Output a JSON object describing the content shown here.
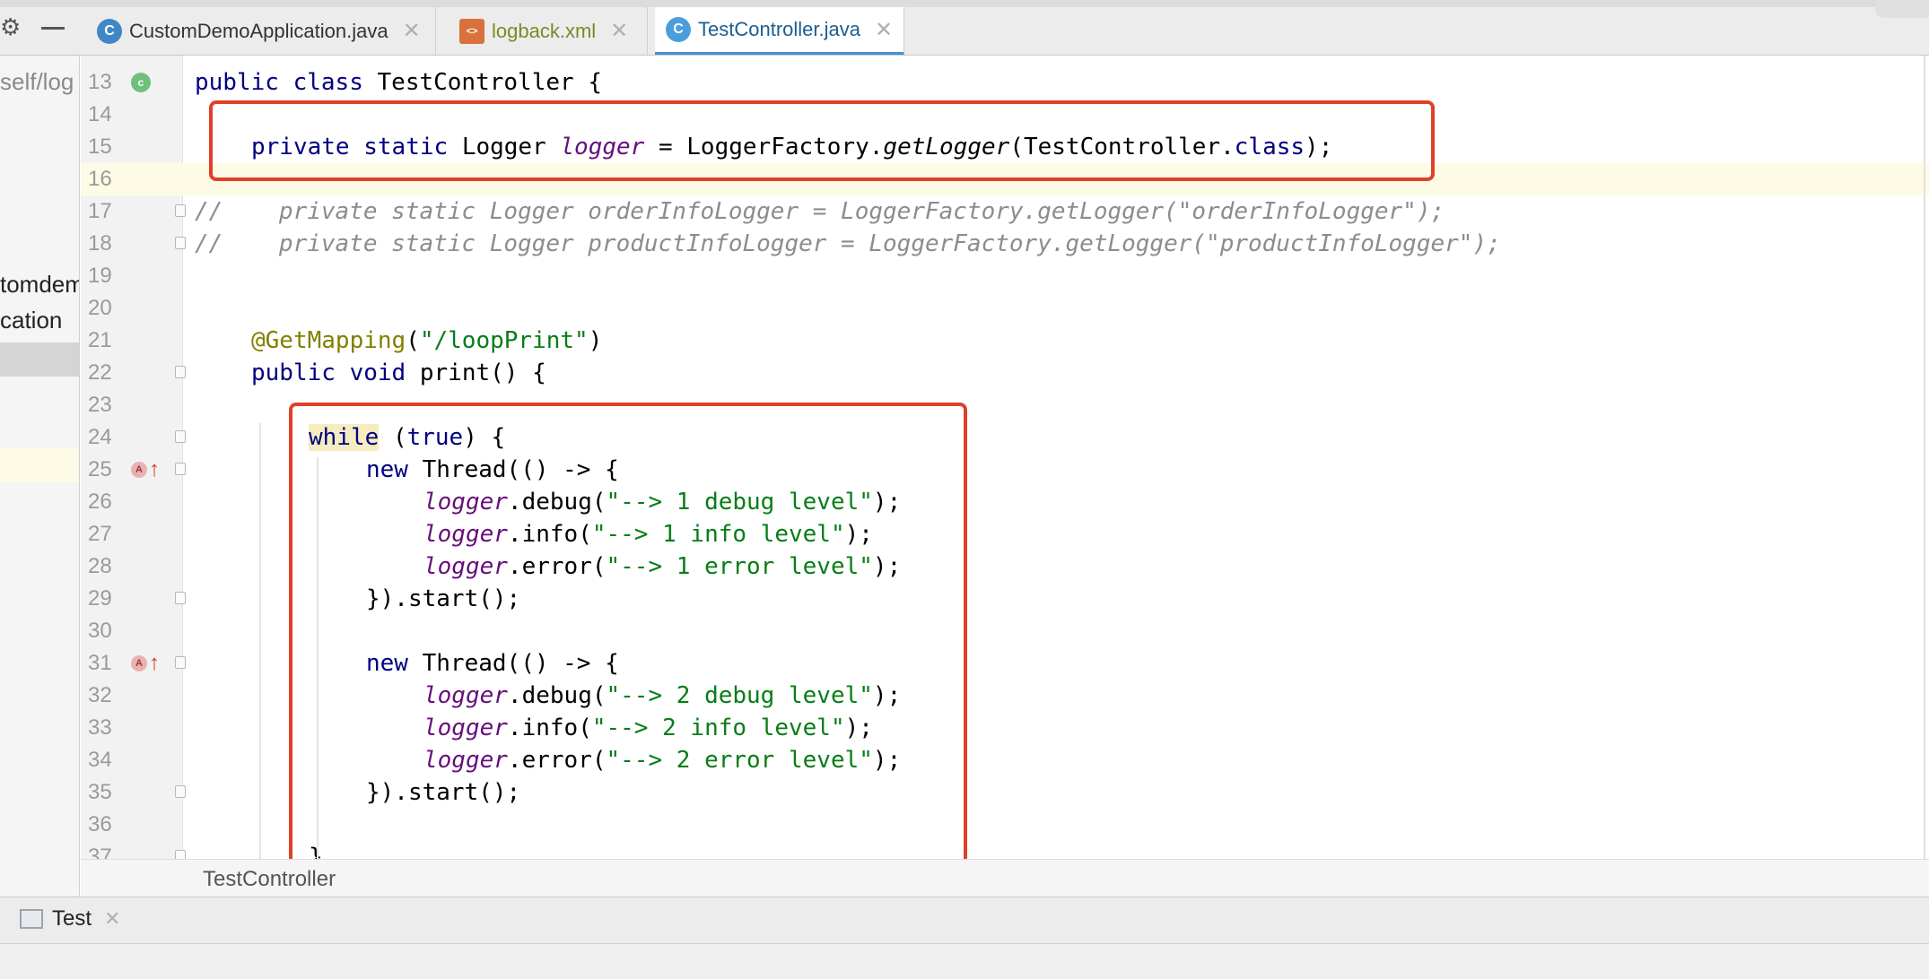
{
  "tabs": [
    {
      "label": "CustomDemoApplication.java",
      "icon": "java-class-run-icon",
      "active": false
    },
    {
      "label": "logback.xml",
      "icon": "xml-file-icon",
      "active": false
    },
    {
      "label": "TestController.java",
      "icon": "java-class-icon",
      "active": true
    }
  ],
  "toolbar": {
    "settings_icon": "gear-icon",
    "hide_icon": "minimize-icon"
  },
  "project_panel": {
    "path_fragment": "self/log",
    "items": [
      "tomdem",
      "cation"
    ]
  },
  "editor": {
    "current_line": 16,
    "lines": [
      {
        "n": "13",
        "marker": "class",
        "fold": false
      },
      {
        "n": "14",
        "marker": "",
        "fold": false
      },
      {
        "n": "15",
        "marker": "",
        "fold": false
      },
      {
        "n": "16",
        "marker": "",
        "fold": false
      },
      {
        "n": "17",
        "marker": "",
        "fold": true
      },
      {
        "n": "18",
        "marker": "",
        "fold": true
      },
      {
        "n": "19",
        "marker": "",
        "fold": false
      },
      {
        "n": "20",
        "marker": "",
        "fold": false
      },
      {
        "n": "21",
        "marker": "",
        "fold": false
      },
      {
        "n": "22",
        "marker": "",
        "fold": true
      },
      {
        "n": "23",
        "marker": "",
        "fold": false
      },
      {
        "n": "24",
        "marker": "",
        "fold": true
      },
      {
        "n": "25",
        "marker": "override",
        "fold": true
      },
      {
        "n": "26",
        "marker": "",
        "fold": false
      },
      {
        "n": "27",
        "marker": "",
        "fold": false
      },
      {
        "n": "28",
        "marker": "",
        "fold": false
      },
      {
        "n": "29",
        "marker": "",
        "fold": true
      },
      {
        "n": "30",
        "marker": "",
        "fold": false
      },
      {
        "n": "31",
        "marker": "override",
        "fold": true
      },
      {
        "n": "32",
        "marker": "",
        "fold": false
      },
      {
        "n": "33",
        "marker": "",
        "fold": false
      },
      {
        "n": "34",
        "marker": "",
        "fold": false
      },
      {
        "n": "35",
        "marker": "",
        "fold": true
      },
      {
        "n": "36",
        "marker": "",
        "fold": false
      },
      {
        "n": "37",
        "marker": "",
        "fold": true
      }
    ],
    "code": {
      "l13": [
        "public",
        "class",
        "TestController {"
      ],
      "l15": [
        "private",
        "static",
        "Logger",
        "logger",
        "= LoggerFactory.",
        "getLogger",
        "(TestController.",
        "class",
        ");"
      ],
      "l17": "//    private static Logger orderInfoLogger = LoggerFactory.getLogger(\"orderInfoLogger\");",
      "l18": "//    private static Logger productInfoLogger = LoggerFactory.getLogger(\"productInfoLogger\");",
      "l21": [
        "@GetMapping",
        "(",
        "\"/loopPrint\"",
        ")"
      ],
      "l22": [
        "public",
        "void",
        "print() {"
      ],
      "l24": [
        "while",
        "(",
        "true",
        ") {"
      ],
      "l25": [
        "new",
        "Thread(() -> {"
      ],
      "l26": [
        "logger",
        ".debug(",
        "\"--> 1 debug level\"",
        ");"
      ],
      "l27": [
        "logger",
        ".info(",
        "\"--> 1 info level\"",
        ");"
      ],
      "l28": [
        "logger",
        ".error(",
        "\"--> 1 error level\"",
        ");"
      ],
      "l29": "}).start();",
      "l31": [
        "new",
        "Thread(() -> {"
      ],
      "l32": [
        "logger",
        ".debug(",
        "\"--> 2 debug level\"",
        ");"
      ],
      "l33": [
        "logger",
        ".info(",
        "\"--> 2 info level\"",
        ");"
      ],
      "l34": [
        "logger",
        ".error(",
        "\"--> 2 error level\"",
        ");"
      ],
      "l35": "}).start();",
      "l37": "}"
    }
  },
  "breadcrumb": "TestController",
  "bottom_tab": {
    "label": "Test",
    "icon": "run-console-icon"
  },
  "colors": {
    "highlight_box": "#e0402a",
    "keyword": "#000080",
    "string": "#067d17",
    "field": "#660e7a",
    "annotation": "#808000",
    "comment": "#8c8c8c"
  }
}
